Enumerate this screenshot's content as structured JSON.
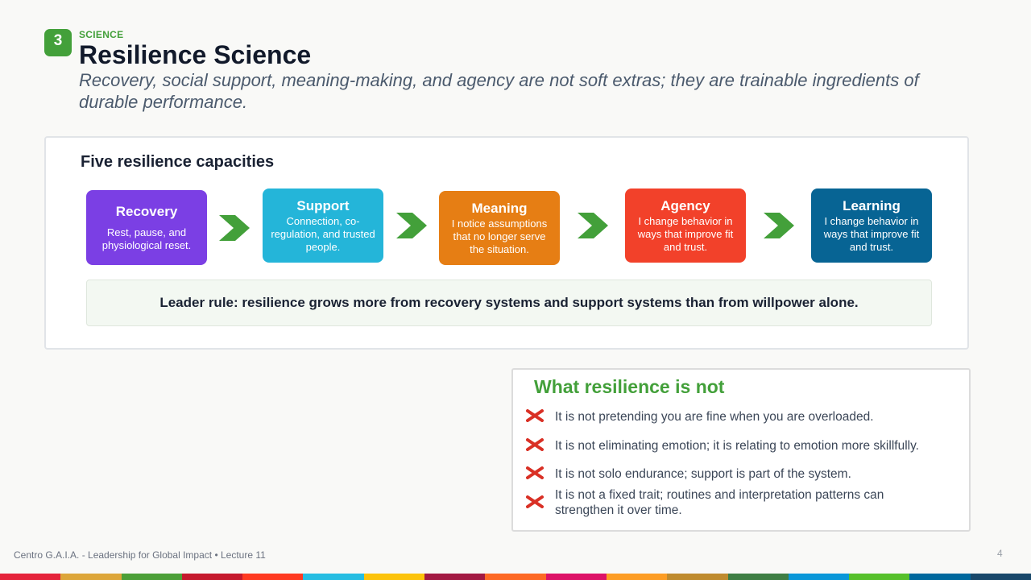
{
  "header": {
    "section_number": "3",
    "kicker": "SCIENCE",
    "title": "Resilience Science",
    "subtitle": "Recovery, social support, meaning-making, and agency are not soft extras; they are trainable ingredients of durable performance."
  },
  "capacities": {
    "title": "Five resilience capacities",
    "items": [
      {
        "name": "Recovery",
        "desc": "Rest, pause, and physiological reset.",
        "color": "#7b3fe4"
      },
      {
        "name": "Support",
        "desc": "Connection, co-regulation, and trusted people.",
        "color": "#24b5d9"
      },
      {
        "name": "Meaning",
        "desc": "I notice assumptions that no longer serve the situation.",
        "color": "#e67e14"
      },
      {
        "name": "Agency",
        "desc": "I change behavior in ways that improve fit and trust.",
        "color": "#f2412a"
      },
      {
        "name": "Learning",
        "desc": "I change behavior in ways that improve fit and trust.",
        "color": "#076494"
      }
    ],
    "arrow_color": "#43a03a",
    "leader_rule": "Leader rule: resilience grows more from recovery systems and support systems than from willpower alone."
  },
  "not_section": {
    "title": "What resilience is not",
    "icon": "red-x-icon",
    "items": [
      "It is not pretending you are fine when you are overloaded.",
      "It is not eliminating emotion; it is relating to emotion more skillfully.",
      "It is not solo endurance; support is part of the system.",
      "It is not a fixed trait; routines and interpretation patterns can strengthen it over time."
    ]
  },
  "footer": {
    "text": "Centro G.A.I.A. - Leadership for Global Impact • Lecture 11",
    "page_number": "4"
  },
  "sdg_colors": [
    "#e5243b",
    "#dda63a",
    "#4c9f38",
    "#c5192d",
    "#ff3a21",
    "#26bde2",
    "#fcc30b",
    "#a21942",
    "#fd6925",
    "#dd1367",
    "#fd9d24",
    "#bf8b2e",
    "#3f7e44",
    "#0a97d9",
    "#56c02b",
    "#00689d",
    "#19486a"
  ]
}
